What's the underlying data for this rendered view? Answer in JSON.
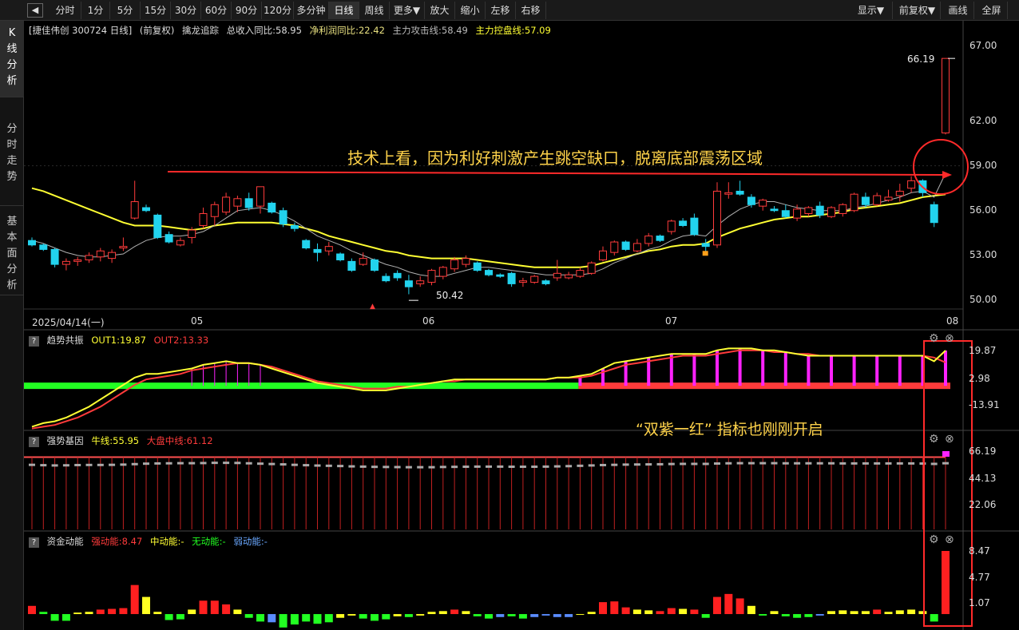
{
  "toolbar": {
    "back": "◀",
    "periods": [
      "分时",
      "1分",
      "5分",
      "15分",
      "30分",
      "60分",
      "90分",
      "120分",
      "多分钟",
      "日线",
      "周线",
      "更多▼",
      "放大",
      "缩小",
      "左移",
      "右移"
    ],
    "active_period": "日线",
    "right": [
      "显示▼",
      "前复权▼",
      "画线",
      "全屏"
    ]
  },
  "sidebar": {
    "tabs": [
      "K\n线\n分\n析",
      "分\n时\n走\n势",
      "基\n本\n面\n分\n析"
    ]
  },
  "main": {
    "stock": "[捷佳伟创 300724 日线]",
    "adjust": "(前复权)",
    "indicator_name": "擒龙追踪",
    "revenue": "总收入同比:58.95",
    "profit": "净利润同比:22.42",
    "attack": "主力攻击线:58.49",
    "control": "主力控盘线:57.09",
    "y_ticks": [
      "67.00",
      "62.00",
      "59.00",
      "56.00",
      "53.00",
      "50.00"
    ],
    "high_label": "66.19",
    "low_label": "50.42",
    "x_labels": [
      "2025/04/14(一)",
      "05",
      "06",
      "07",
      "08"
    ],
    "annotation": "技术上看，因为利好刺激产生跳空缺口，脱离底部震荡区域"
  },
  "trend": {
    "name": "趋势共振",
    "out1": "OUT1:19.87",
    "out2": "OUT2:13.33",
    "y_ticks": [
      "19.87",
      "2.98",
      "-13.91"
    ],
    "annotation": "“双紫一红” 指标也刚刚开启"
  },
  "gene": {
    "name": "强势基因",
    "bull": "牛线:55.95",
    "market": "大盘中线:61.12",
    "y_ticks": [
      "66.19",
      "44.13",
      "22.06"
    ]
  },
  "fund": {
    "name": "资金动能",
    "strong": "强动能:8.47",
    "mid": "中动能:-",
    "none": "无动能:-",
    "weak": "弱动能:-",
    "y_ticks": [
      "8.47",
      "4.77",
      "1.07"
    ]
  },
  "colors": {
    "up": "#ff3b3b",
    "down": "#22d3ee",
    "ma_yellow": "#ffff33",
    "annotation": "#ffd34a",
    "magenta": "#ff22ff",
    "green": "#22ff22"
  },
  "chart_data": {
    "type": "candlestick",
    "y_range": [
      50.0,
      67.0
    ],
    "candles": [
      [
        54.0,
        54.2,
        53.6,
        53.7
      ],
      [
        53.7,
        53.8,
        53.3,
        53.4
      ],
      [
        53.4,
        53.5,
        52.2,
        52.4
      ],
      [
        52.4,
        52.8,
        52.0,
        52.6
      ],
      [
        52.6,
        52.9,
        52.3,
        52.7
      ],
      [
        52.7,
        53.2,
        52.5,
        53.0
      ],
      [
        52.9,
        53.5,
        52.6,
        53.3
      ],
      [
        52.8,
        53.4,
        52.5,
        53.2
      ],
      [
        53.5,
        54.2,
        53.3,
        53.6
      ],
      [
        55.5,
        58.0,
        55.4,
        56.6
      ],
      [
        56.2,
        56.4,
        55.9,
        56.0
      ],
      [
        55.7,
        55.8,
        54.1,
        54.2
      ],
      [
        54.4,
        54.6,
        53.8,
        53.9
      ],
      [
        53.7,
        54.2,
        53.6,
        54.0
      ],
      [
        54.2,
        54.9,
        53.8,
        54.7
      ],
      [
        55.0,
        56.2,
        54.8,
        55.8
      ],
      [
        55.6,
        56.6,
        55.0,
        56.4
      ],
      [
        55.9,
        57.2,
        55.7,
        56.9
      ],
      [
        56.3,
        57.0,
        55.9,
        56.8
      ],
      [
        56.8,
        57.2,
        56.0,
        56.2
      ],
      [
        56.3,
        57.5,
        55.8,
        57.6
      ],
      [
        56.5,
        56.6,
        55.8,
        55.9
      ],
      [
        56.0,
        56.2,
        54.9,
        55.1
      ],
      [
        55.0,
        55.2,
        54.6,
        54.8
      ],
      [
        54.0,
        54.1,
        53.4,
        53.5
      ],
      [
        53.4,
        53.8,
        52.6,
        53.2
      ],
      [
        53.3,
        53.9,
        53.0,
        53.6
      ],
      [
        53.1,
        53.2,
        52.6,
        52.7
      ],
      [
        52.6,
        52.8,
        51.9,
        52.0
      ],
      [
        52.4,
        53.2,
        52.3,
        52.8
      ],
      [
        52.7,
        52.8,
        51.9,
        52.0
      ],
      [
        51.6,
        51.8,
        51.2,
        51.3
      ],
      [
        51.8,
        52.0,
        51.3,
        51.5
      ],
      [
        51.3,
        51.7,
        50.4,
        50.9
      ],
      [
        51.1,
        51.6,
        50.9,
        51.3
      ],
      [
        51.2,
        52.1,
        51.0,
        52.0
      ],
      [
        51.6,
        52.3,
        51.4,
        52.2
      ],
      [
        52.1,
        52.9,
        51.9,
        52.7
      ],
      [
        52.4,
        53.0,
        52.2,
        52.8
      ],
      [
        52.5,
        52.6,
        51.9,
        52.0
      ],
      [
        52.0,
        52.1,
        51.6,
        51.7
      ],
      [
        51.7,
        51.8,
        51.5,
        51.6
      ],
      [
        51.8,
        51.9,
        50.9,
        51.1
      ],
      [
        51.2,
        51.5,
        50.9,
        51.3
      ],
      [
        51.2,
        51.7,
        51.1,
        51.6
      ],
      [
        51.3,
        51.4,
        51.0,
        51.1
      ],
      [
        51.5,
        52.7,
        51.3,
        51.8
      ],
      [
        51.5,
        51.9,
        51.4,
        51.7
      ],
      [
        51.6,
        52.2,
        51.5,
        52.0
      ],
      [
        51.8,
        52.6,
        51.7,
        52.5
      ],
      [
        52.7,
        53.6,
        52.6,
        53.3
      ],
      [
        53.2,
        54.0,
        53.0,
        53.9
      ],
      [
        53.9,
        54.0,
        53.3,
        53.4
      ],
      [
        53.3,
        54.1,
        53.2,
        53.8
      ],
      [
        53.8,
        54.5,
        53.6,
        54.3
      ],
      [
        54.3,
        54.4,
        53.9,
        54.0
      ],
      [
        54.6,
        55.4,
        54.4,
        55.3
      ],
      [
        55.3,
        55.5,
        54.9,
        55.0
      ],
      [
        55.5,
        55.8,
        54.3,
        54.4
      ],
      [
        53.8,
        54.1,
        53.2,
        53.6
      ],
      [
        53.7,
        57.9,
        53.5,
        57.3
      ],
      [
        57.1,
        57.9,
        56.8,
        57.2
      ],
      [
        57.3,
        58.0,
        57.0,
        57.1
      ],
      [
        56.9,
        57.1,
        56.2,
        56.4
      ],
      [
        56.3,
        56.8,
        56.0,
        56.7
      ],
      [
        56.1,
        56.3,
        55.9,
        56.0
      ],
      [
        56.0,
        56.4,
        55.5,
        55.6
      ],
      [
        55.5,
        56.4,
        55.3,
        56.1
      ],
      [
        55.8,
        56.3,
        55.6,
        56.2
      ],
      [
        56.3,
        56.6,
        55.5,
        55.7
      ],
      [
        55.6,
        56.3,
        55.5,
        56.2
      ],
      [
        55.8,
        56.5,
        55.6,
        56.4
      ],
      [
        56.0,
        57.2,
        55.9,
        57.1
      ],
      [
        56.9,
        57.2,
        56.2,
        56.4
      ],
      [
        56.4,
        57.2,
        56.3,
        57.0
      ],
      [
        56.7,
        57.4,
        56.6,
        56.9
      ],
      [
        57.0,
        57.8,
        56.6,
        57.3
      ],
      [
        57.5,
        58.3,
        57.2,
        58.0
      ],
      [
        58.0,
        58.1,
        56.9,
        57.2
      ],
      [
        56.4,
        56.6,
        54.9,
        55.2
      ],
      [
        61.2,
        66.2,
        61.1,
        66.19
      ]
    ],
    "ma_white": [
      54.0,
      53.8,
      53.5,
      53.2,
      53.0,
      52.9,
      52.9,
      53.0,
      53.1,
      53.6,
      54.0,
      54.2,
      54.3,
      54.3,
      54.4,
      54.6,
      55.0,
      55.5,
      56.0,
      56.1,
      56.2,
      56.0,
      55.7,
      55.3,
      54.8,
      54.3,
      54.0,
      53.7,
      53.3,
      53.0,
      52.7,
      52.4,
      52.2,
      51.9,
      51.7,
      51.6,
      51.6,
      51.8,
      52.0,
      52.2,
      52.2,
      52.1,
      52.0,
      51.9,
      51.8,
      51.7,
      51.7,
      51.7,
      51.7,
      51.8,
      52.1,
      52.5,
      52.8,
      53.1,
      53.4,
      53.6,
      54.0,
      54.3,
      54.4,
      54.3,
      55.0,
      55.6,
      56.1,
      56.4,
      56.6,
      56.6,
      56.4,
      56.2,
      56.1,
      56.0,
      56.0,
      56.0,
      56.2,
      56.3,
      56.5,
      56.7,
      56.9,
      57.2,
      57.3,
      56.9,
      58.5
    ],
    "ma_yellow": [
      57.5,
      57.3,
      57.0,
      56.7,
      56.4,
      56.1,
      55.8,
      55.5,
      55.2,
      55.0,
      55.0,
      55.0,
      54.9,
      54.8,
      54.7,
      54.8,
      55.0,
      55.1,
      55.2,
      55.2,
      55.2,
      55.2,
      55.1,
      55.0,
      54.8,
      54.6,
      54.3,
      54.1,
      53.9,
      53.7,
      53.5,
      53.3,
      53.2,
      53.0,
      52.9,
      52.8,
      52.8,
      52.8,
      52.8,
      52.7,
      52.6,
      52.5,
      52.4,
      52.3,
      52.2,
      52.2,
      52.2,
      52.2,
      52.2,
      52.3,
      52.5,
      52.7,
      52.9,
      53.1,
      53.3,
      53.4,
      53.6,
      53.7,
      53.7,
      53.8,
      54.2,
      54.5,
      54.8,
      55.0,
      55.2,
      55.4,
      55.5,
      55.6,
      55.6,
      55.7,
      55.8,
      55.9,
      56.1,
      56.2,
      56.3,
      56.4,
      56.5,
      56.7,
      56.9,
      57.0,
      57.09
    ],
    "trend_out1": [
      -22,
      -20,
      -19,
      -17,
      -14,
      -11,
      -7,
      -3,
      1,
      5,
      7,
      7,
      8,
      9,
      10,
      12,
      13,
      14,
      13,
      13,
      12,
      10,
      8,
      6,
      4,
      2,
      1,
      0,
      -1,
      -2,
      -2,
      -2,
      -1,
      0,
      1,
      2,
      3,
      4,
      4,
      4,
      4,
      4,
      4,
      4,
      4,
      4,
      5,
      5,
      6,
      7,
      10,
      13,
      14,
      15,
      16,
      17,
      18,
      18,
      18,
      18,
      20,
      21,
      21,
      21,
      20,
      20,
      19,
      18,
      17,
      17,
      17,
      17,
      17,
      17,
      17,
      17,
      17,
      17,
      17,
      14,
      19.87
    ],
    "trend_out2": [
      -23,
      -22,
      -21,
      -19,
      -17,
      -14,
      -11,
      -7,
      -3,
      1,
      4,
      5,
      6,
      7,
      9,
      10,
      11,
      12,
      13,
      13,
      12,
      11,
      9,
      7,
      5,
      3,
      2,
      1,
      0,
      -1,
      -1,
      -1,
      0,
      0,
      1,
      2,
      3,
      3,
      4,
      4,
      4,
      4,
      4,
      4,
      4,
      4,
      5,
      5,
      5,
      6,
      8,
      10,
      12,
      13,
      14,
      15,
      16,
      17,
      17,
      17,
      18,
      19,
      20,
      20,
      20,
      19,
      19,
      18,
      18,
      17,
      17,
      17,
      17,
      17,
      17,
      17,
      17,
      17,
      17,
      16,
      13.33
    ],
    "trend_magenta_start": 48,
    "gene_bull": [
      54.6,
      54.3,
      54.1,
      54.2,
      54.4,
      54.5,
      54.5,
      54.6,
      54.8,
      55.2,
      55.6,
      55.8,
      55.9,
      56.0,
      56.0,
      56.1,
      56.3,
      56.3,
      56.2,
      55.9,
      55.6,
      55.3,
      55.0,
      54.6,
      54.3,
      54.0,
      53.8,
      53.6,
      53.3,
      53.1,
      52.9,
      52.8,
      52.7,
      52.6,
      52.6,
      52.6,
      52.8,
      52.9,
      53.0,
      53.1,
      53.1,
      53.1,
      53.0,
      53.0,
      53.0,
      53.1,
      53.3,
      53.5,
      53.8,
      54.1,
      54.4,
      54.6,
      54.8,
      54.9,
      55.0,
      55.1,
      55.3,
      55.4,
      55.4,
      55.4,
      55.7,
      55.9,
      56.0,
      56.0,
      56.0,
      56.0,
      55.9,
      55.9,
      55.9,
      55.9,
      55.9,
      55.8,
      55.8,
      55.8,
      55.8,
      55.8,
      55.8,
      55.8,
      55.7,
      55.4,
      55.95
    ],
    "gene_market": 61.12,
    "fund_values": [
      1.1,
      0.3,
      -0.9,
      -0.9,
      0.2,
      0.3,
      0.6,
      0.7,
      0.8,
      3.9,
      2.3,
      0.3,
      -0.8,
      -0.7,
      0.6,
      1.8,
      1.8,
      1.3,
      0.6,
      -0.5,
      -1.0,
      -1.1,
      -1.8,
      -1.4,
      -1.0,
      -1.3,
      -1.1,
      -0.5,
      -0.2,
      -0.6,
      -0.9,
      -0.7,
      -0.3,
      -0.4,
      -0.2,
      0.3,
      0.4,
      0.6,
      0.4,
      -0.3,
      -0.6,
      -0.4,
      -0.3,
      -0.6,
      -0.4,
      -0.2,
      -0.4,
      -0.4,
      -0.1,
      0.3,
      1.6,
      1.7,
      0.9,
      0.6,
      0.5,
      0.4,
      0.8,
      0.7,
      0.6,
      -0.5,
      2.3,
      2.7,
      2.1,
      1.1,
      -0.2,
      0.4,
      -0.3,
      -0.5,
      -0.4,
      -0.2,
      0.4,
      0.5,
      0.4,
      0.4,
      0.6,
      0.3,
      0.5,
      0.6,
      0.4,
      -1.0,
      8.47
    ],
    "fund_colors": [
      "r",
      "g",
      "g",
      "g",
      "y",
      "y",
      "r",
      "r",
      "r",
      "r",
      "y",
      "y",
      "g",
      "g",
      "y",
      "r",
      "r",
      "r",
      "y",
      "g",
      "g",
      "b",
      "g",
      "g",
      "g",
      "g",
      "g",
      "y",
      "y",
      "g",
      "g",
      "g",
      "y",
      "g",
      "y",
      "y",
      "y",
      "r",
      "y",
      "g",
      "g",
      "b",
      "g",
      "g",
      "b",
      "b",
      "b",
      "b",
      "y",
      "y",
      "r",
      "r",
      "r",
      "y",
      "y",
      "r",
      "r",
      "y",
      "r",
      "g",
      "r",
      "r",
      "r",
      "y",
      "g",
      "y",
      "g",
      "g",
      "g",
      "b",
      "y",
      "y",
      "y",
      "y",
      "r",
      "y",
      "y",
      "y",
      "y",
      "g",
      "r"
    ]
  }
}
